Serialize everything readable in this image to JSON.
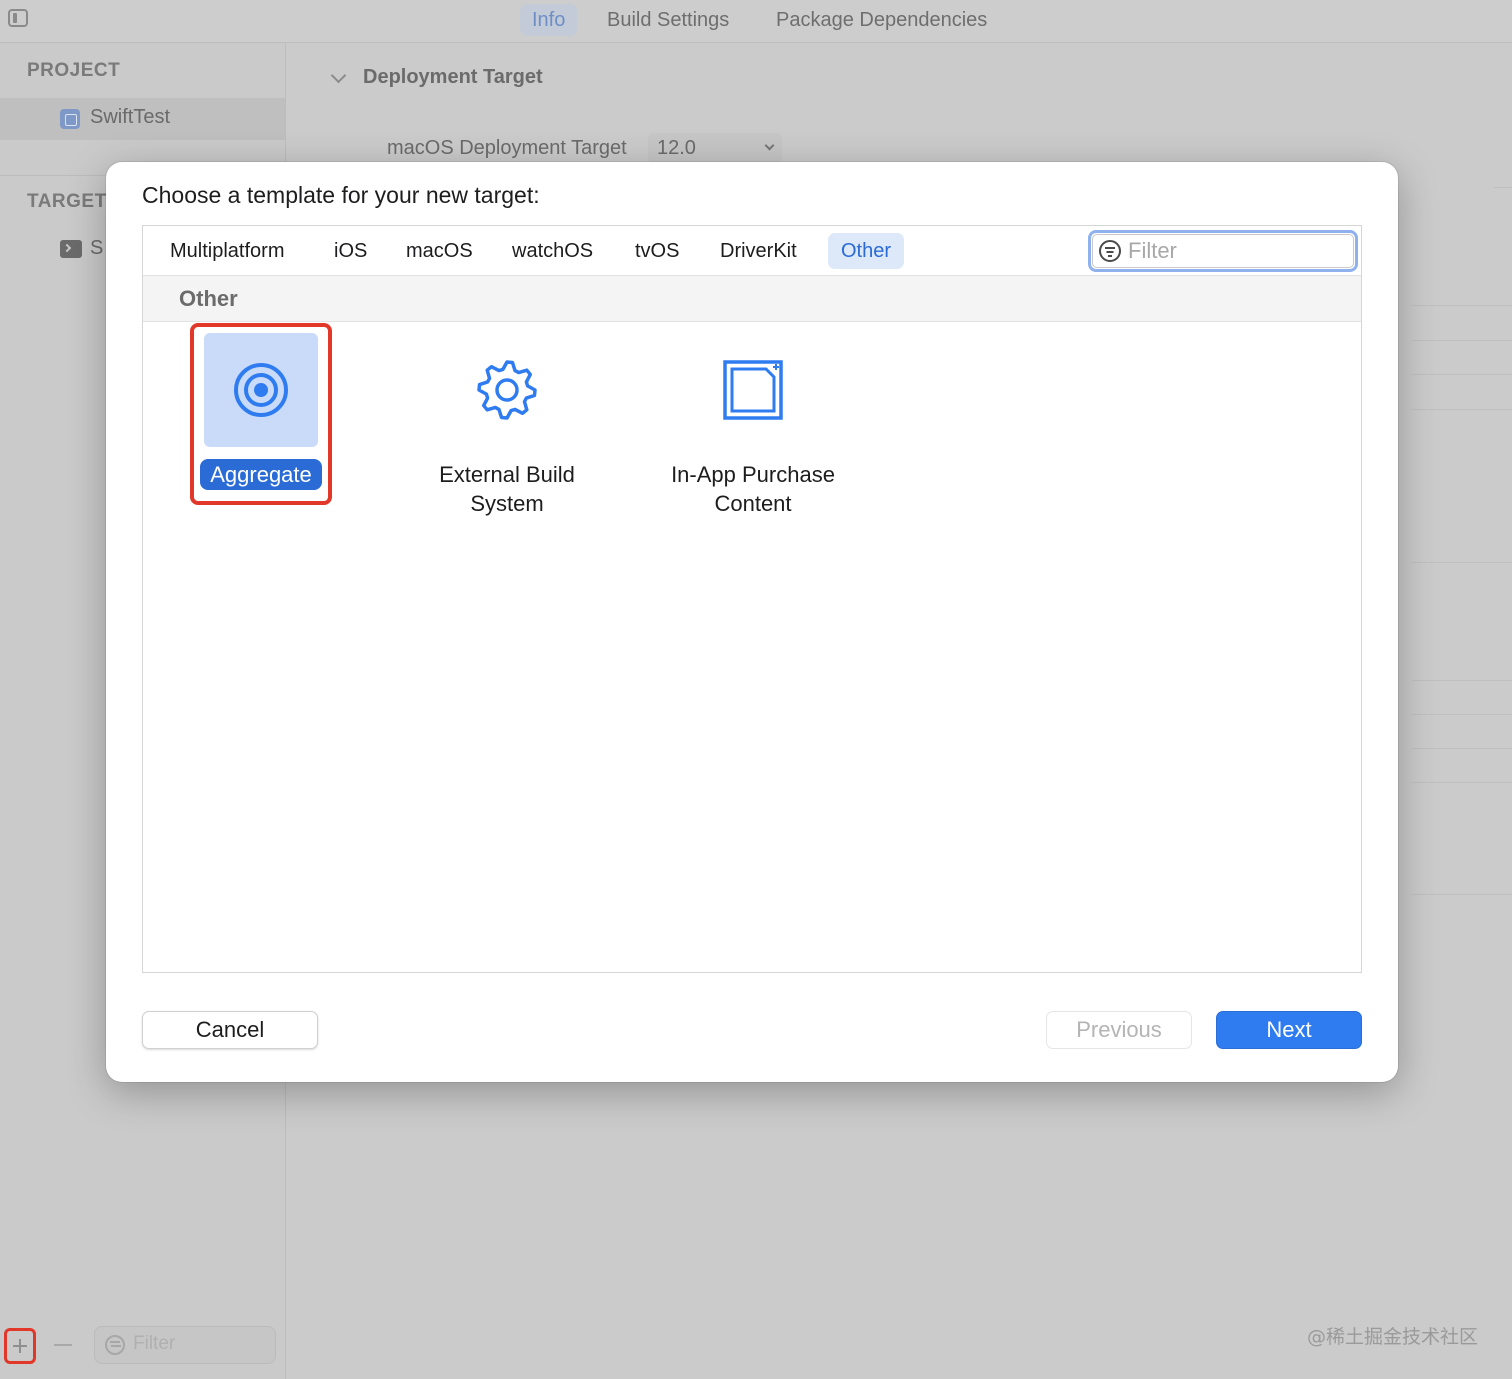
{
  "editor_tabs": [
    {
      "label": "Info",
      "active": true
    },
    {
      "label": "Build Settings",
      "active": false
    },
    {
      "label": "Package Dependencies",
      "active": false
    }
  ],
  "sidebar": {
    "project_header": "PROJECT",
    "project_name": "SwiftTest",
    "targets_header": "TARGET",
    "target_name": "S",
    "filter_placeholder": "Filter"
  },
  "deployment": {
    "section_title": "Deployment Target",
    "label": "macOS Deployment Target",
    "value": "12.0"
  },
  "watermark": "@稀土掘金技术社区",
  "dialog": {
    "title": "Choose a template for your new target:",
    "platform_tabs": [
      {
        "label": "Multiplatform",
        "active": false
      },
      {
        "label": "iOS",
        "active": false
      },
      {
        "label": "macOS",
        "active": false
      },
      {
        "label": "watchOS",
        "active": false
      },
      {
        "label": "tvOS",
        "active": false
      },
      {
        "label": "DriverKit",
        "active": false
      },
      {
        "label": "Other",
        "active": true
      }
    ],
    "filter_placeholder": "Filter",
    "group_header": "Other",
    "templates": [
      {
        "label": "Aggregate",
        "icon": "target-icon",
        "selected": true
      },
      {
        "label": "External Build\nSystem",
        "icon": "gear-icon",
        "selected": false
      },
      {
        "label": "In-App Purchase\nContent",
        "icon": "in-app-purchase-icon",
        "selected": false
      }
    ],
    "buttons": {
      "cancel": "Cancel",
      "previous": "Previous",
      "next": "Next"
    }
  },
  "colors": {
    "accent": "#2f7cf0",
    "selection_bg": "#c9dbf9",
    "highlight_outline": "#e2382a"
  }
}
